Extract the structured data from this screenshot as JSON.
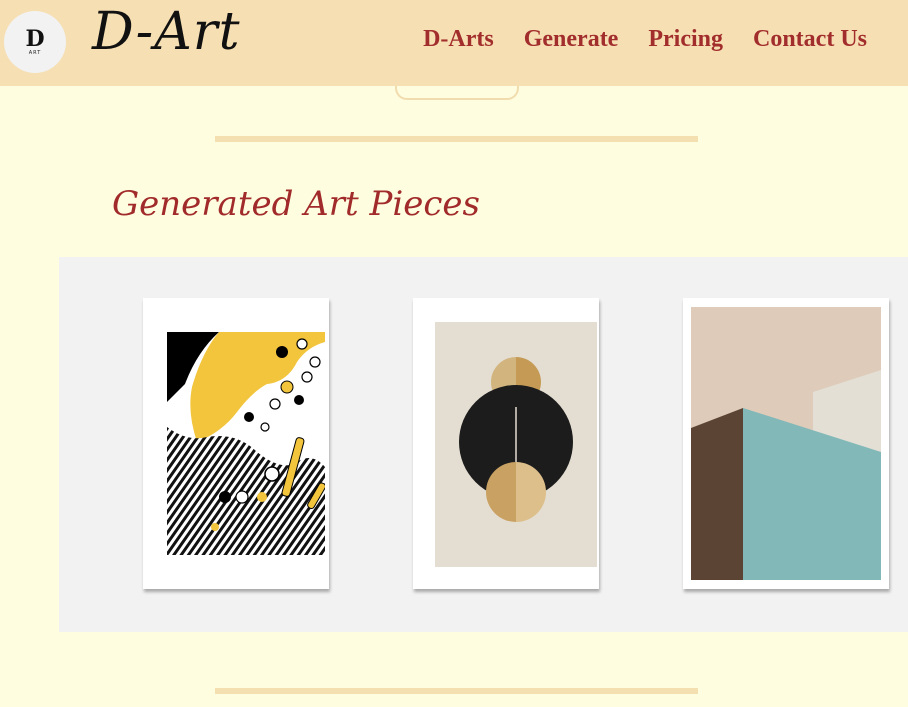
{
  "header": {
    "logo": {
      "mark": "D",
      "sub": "ART"
    },
    "brand": "D-Art",
    "nav": [
      "D-Arts",
      "Generate",
      "Pricing",
      "Contact Us"
    ]
  },
  "section": {
    "title": "Generated Art Pieces"
  },
  "artworks": [
    {
      "name": "abstract-yellow-black-artwork",
      "colors": [
        "#f2c53d",
        "#000000",
        "#ffffff"
      ]
    },
    {
      "name": "geometric-circle-artwork",
      "colors": [
        "#e4ddd1",
        "#1c1c1c",
        "#c9a263"
      ]
    },
    {
      "name": "architecture-pastel-artwork",
      "colors": [
        "#decbba",
        "#82b8b7",
        "#5b4434",
        "#e3dfd5"
      ]
    }
  ],
  "colors": {
    "page_background": "#fffddf",
    "header_background": "#f6dfb2",
    "nav_text": "#a22d2d",
    "title_text": "#a12a2a",
    "divider": "#f4dfb0",
    "gallery_background": "#f2f2f2"
  }
}
